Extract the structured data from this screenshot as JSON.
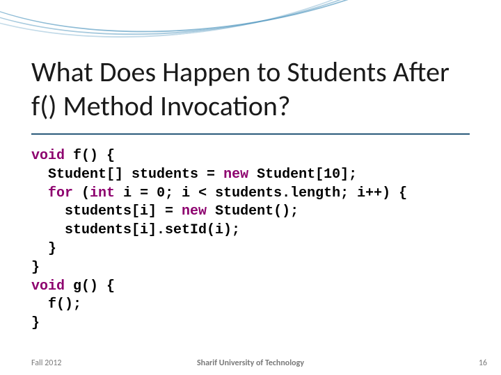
{
  "title": "What Does Happen to Students After f() Method Invocation?",
  "code": {
    "l1": {
      "kw_void": "void",
      "rest": " f() {"
    },
    "l2": {
      "indent": "  ",
      "a": "Student[] students = ",
      "kw_new": "new",
      "b": " Student[10];"
    },
    "l3": {
      "indent": "  ",
      "kw_for": "for",
      "a": " (",
      "kw_int": "int",
      "b": " i = 0; i < students.length; i++) {"
    },
    "l4": {
      "indent": "    ",
      "a": "students[i] = ",
      "kw_new": "new",
      "b": " Student();"
    },
    "l5": {
      "indent": "    ",
      "a": "students[i].setId(i);"
    },
    "l6": "  }",
    "l7": "}",
    "l8": {
      "kw_void": "void",
      "rest": " g() {"
    },
    "l9": "  f();",
    "l10": "}"
  },
  "footer": {
    "left": "Fall 2012",
    "center": "Sharif University of Technology",
    "right": "16"
  }
}
